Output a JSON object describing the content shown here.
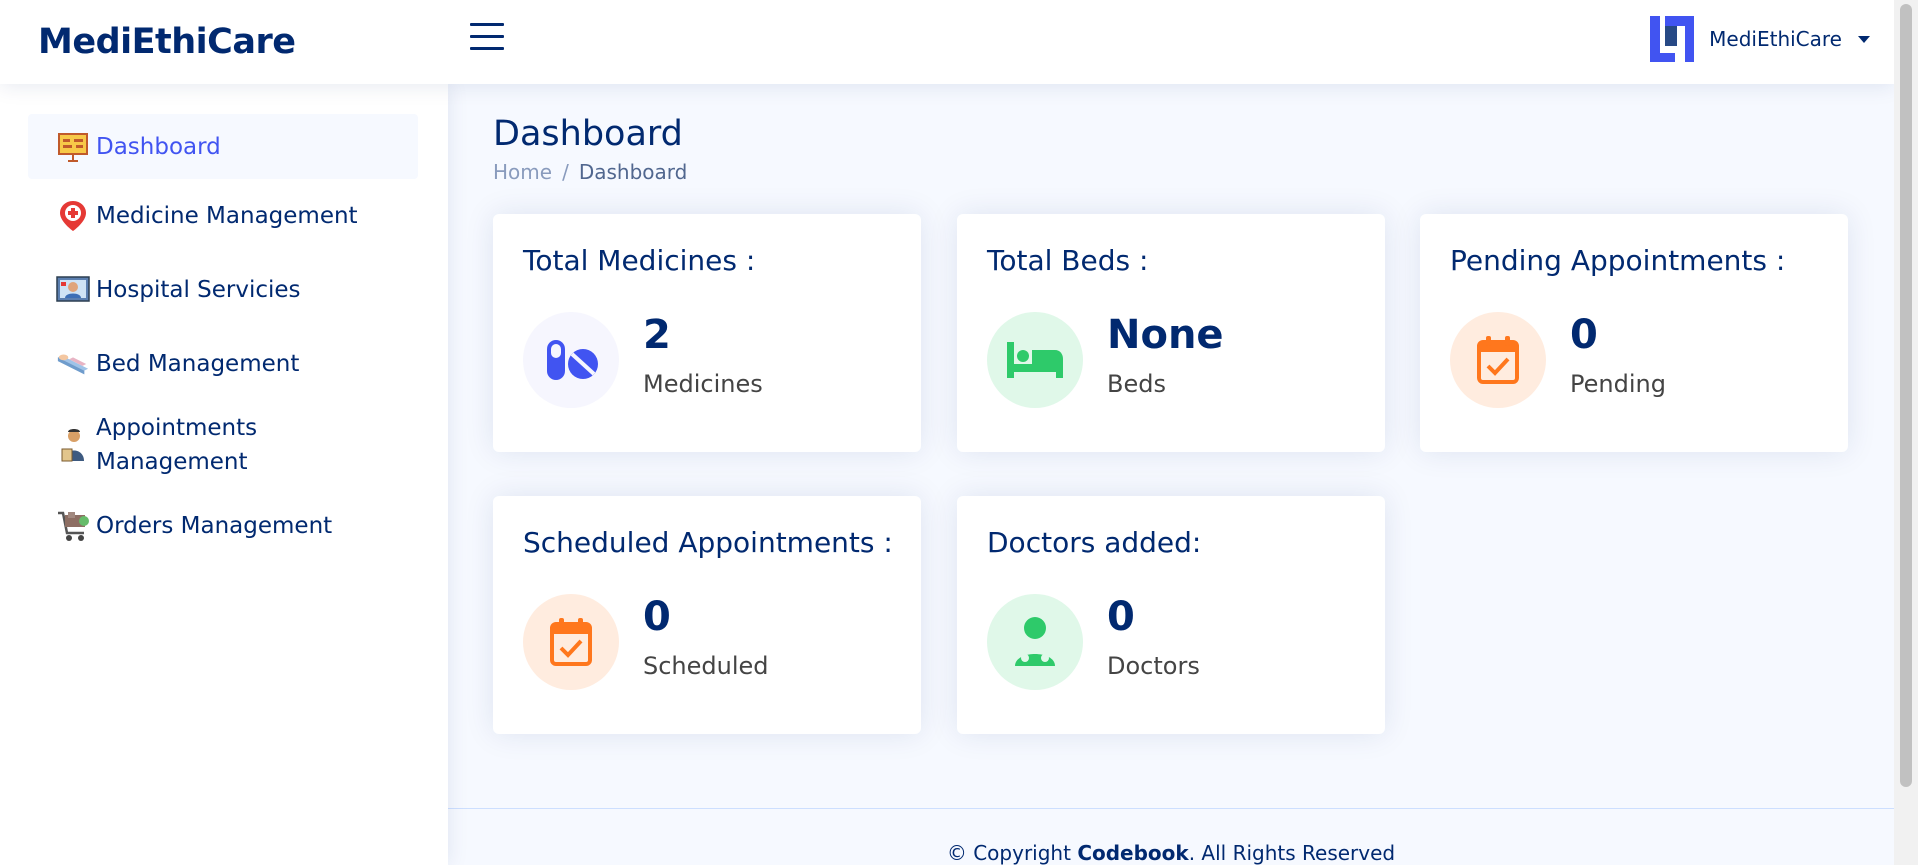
{
  "header": {
    "logo_text": "MediEthiCare",
    "profile_name": "MediEthiCare"
  },
  "sidebar": {
    "items": [
      {
        "label": "Dashboard",
        "icon": "dashboard-board-icon",
        "active": true
      },
      {
        "label": "Medicine Management",
        "icon": "medicine-pin-icon"
      },
      {
        "label": "Hospital Servicies",
        "icon": "hospital-service-icon"
      },
      {
        "label": "Bed Management",
        "icon": "bed-icon"
      },
      {
        "label": "Appointments Management",
        "icon": "appointment-person-icon"
      },
      {
        "label": "Orders Management",
        "icon": "shopping-cart-icon"
      }
    ]
  },
  "page": {
    "title": "Dashboard",
    "breadcrumb": {
      "home": "Home",
      "separator": "/",
      "current": "Dashboard"
    }
  },
  "cards": [
    {
      "title": "Total Medicines :",
      "value": "2",
      "unit": "Medicines",
      "icon": "pills-icon",
      "color": "#4154f1"
    },
    {
      "title": "Total Beds :",
      "value": "None",
      "unit": "Beds",
      "icon": "bed-icon",
      "color": "#2eca6a"
    },
    {
      "title": "Pending Appointments :",
      "value": "0",
      "unit": "Pending",
      "icon": "calendar-check-icon",
      "color": "#ff771d"
    },
    {
      "title": "Scheduled Appointments :",
      "value": "0",
      "unit": "Scheduled",
      "icon": "calendar-check-icon",
      "color": "#ff771d"
    },
    {
      "title": "Doctors added:",
      "value": "0",
      "unit": "Doctors",
      "icon": "doctor-icon",
      "color": "#2eca6a"
    }
  ],
  "footer": {
    "prefix": "© Copyright ",
    "brand": "Codebook",
    "suffix": ". All Rights Reserved"
  }
}
